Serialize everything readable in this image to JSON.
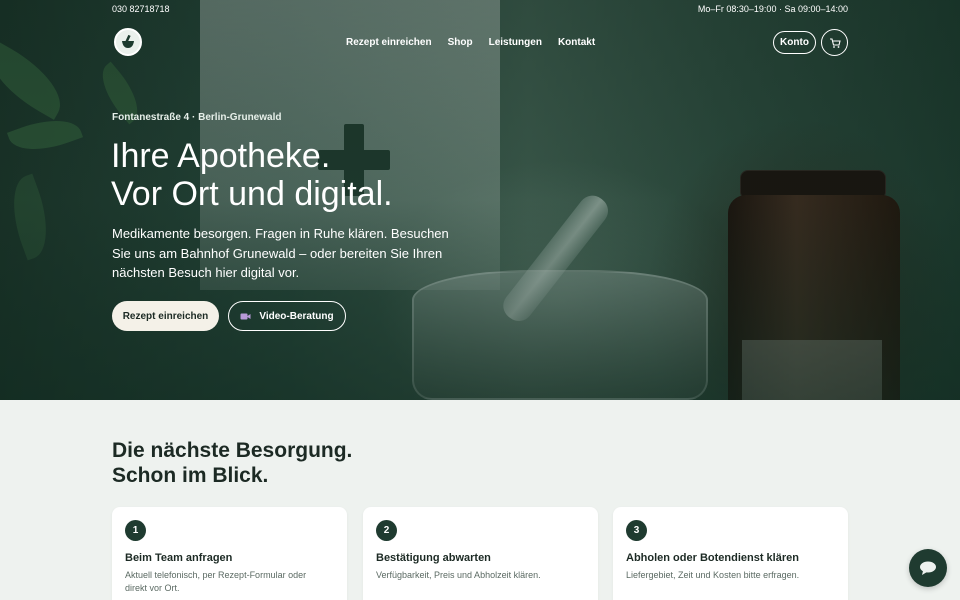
{
  "topbar": {
    "phone": "030 82718718",
    "hours": "Mo–Fr 08:30–19:00 · Sa 09:00–14:00"
  },
  "brand": {
    "logo_icon": "mortar-logo-icon"
  },
  "nav": {
    "items": [
      {
        "label": "Rezept einreichen"
      },
      {
        "label": "Shop"
      },
      {
        "label": "Leistungen"
      },
      {
        "label": "Kontakt"
      }
    ]
  },
  "account": {
    "label": "Konto",
    "cart_icon": "cart-icon"
  },
  "hero": {
    "address": "Fontanestraße 4 · Berlin-Grunewald",
    "headline_line1": "Ihre Apotheke.",
    "headline_line2": "Vor Ort und digital.",
    "lead": "Medikamente besorgen. Fragen in Ruhe klären. Besuchen Sie uns am Bahnhof Grunewald – oder bereiten Sie Ihren nächsten Besuch hier digital vor.",
    "primary_button": "Rezept einreichen",
    "secondary_button": "Video-Beratung",
    "secondary_icon": "video-camera-icon"
  },
  "steps": {
    "title_line1": "Die nächste Besorgung.",
    "title_line2": "Schon im Blick.",
    "cards": [
      {
        "number": "1",
        "title": "Beim Team anfragen",
        "text": "Aktuell telefonisch, per Rezept-Formular oder direkt vor Ort."
      },
      {
        "number": "2",
        "title": "Bestätigung abwarten",
        "text": "Verfügbarkeit, Preis und Abholzeit klären."
      },
      {
        "number": "3",
        "title": "Abholen oder Botendienst klären",
        "text": "Liefergebiet, Zeit und Kosten bitte erfragen."
      }
    ]
  },
  "chat": {
    "icon": "chat-bubble-icon"
  },
  "colors": {
    "dark_green": "#1f3b30",
    "cream": "#f4f1e8",
    "section_bg": "#eef2ef"
  }
}
